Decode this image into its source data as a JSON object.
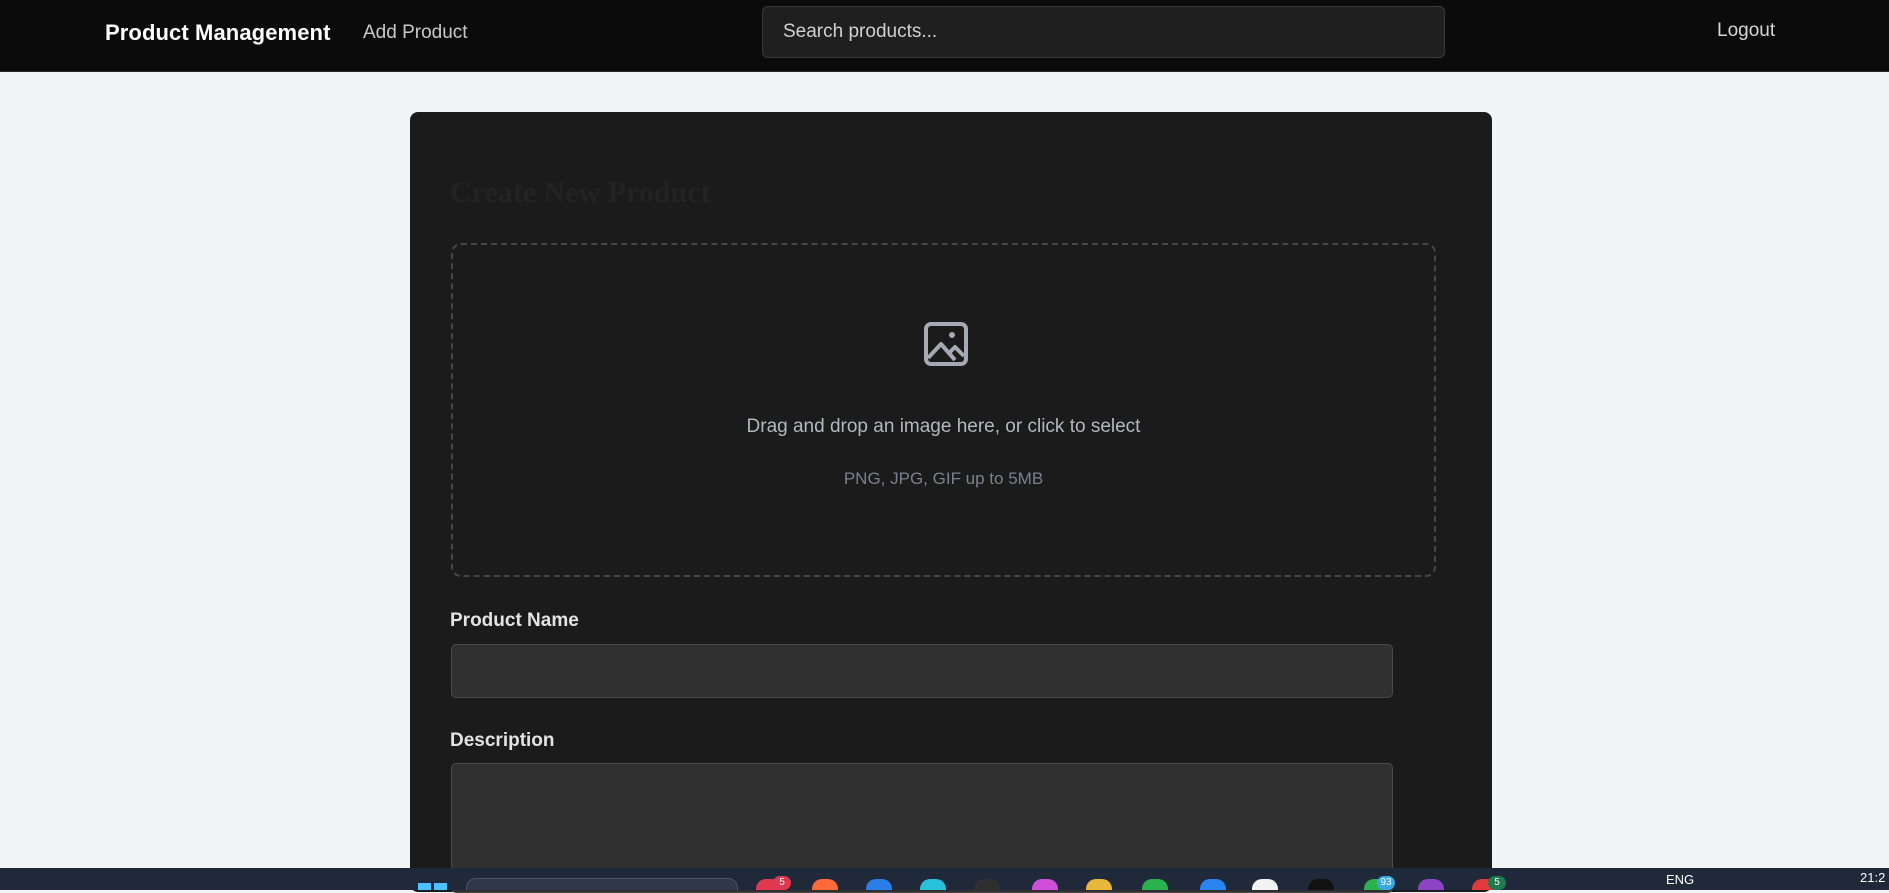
{
  "navbar": {
    "brand": "Product Management",
    "add_product_link": "Add Product",
    "search_placeholder": "Search products...",
    "logout_label": "Logout"
  },
  "form": {
    "title": "Create New Product",
    "dropzone": {
      "icon": "image-icon",
      "text": "Drag and drop an image here, or click to select",
      "hint": "PNG, JPG, GIF up to 5MB"
    },
    "product_name": {
      "label": "Product Name",
      "value": ""
    },
    "description": {
      "label": "Description",
      "value": ""
    }
  },
  "taskbar": {
    "start_icon": "windows-start-icon",
    "search_icon": "search-icon",
    "badges": [
      "5",
      "93",
      "5"
    ],
    "language": "ENG",
    "time": "21:2"
  },
  "colors": {
    "navbar_bg": "#0b0b0b",
    "page_bg": "#f3f4f6",
    "card_bg": "#1b1b1b",
    "input_bg": "#303030",
    "taskbar_bg": "#202939"
  }
}
